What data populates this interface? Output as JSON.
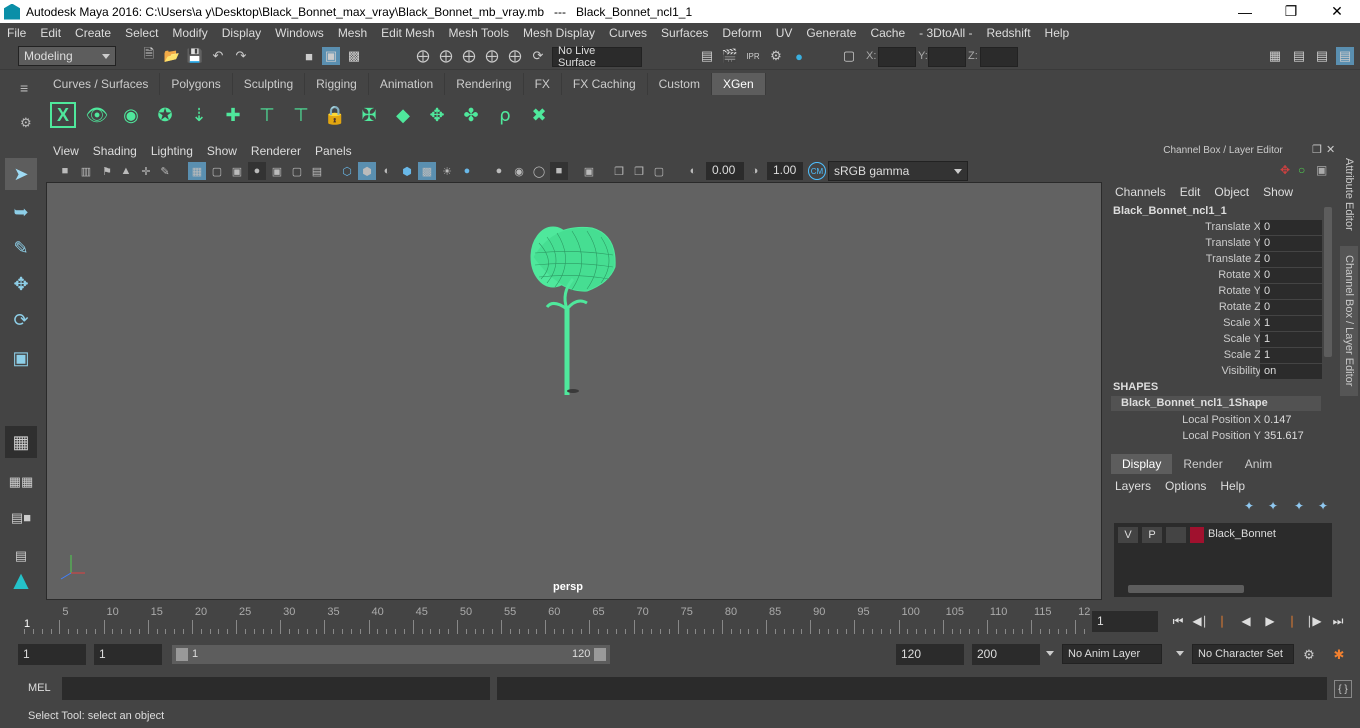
{
  "title": "Autodesk Maya 2016: C:\\Users\\a y\\Desktop\\Black_Bonnet_max_vray\\Black_Bonnet_mb_vray.mb   ---   Black_Bonnet_ncl1_1",
  "menubar": [
    "File",
    "Edit",
    "Create",
    "Select",
    "Modify",
    "Display",
    "Windows",
    "Mesh",
    "Edit Mesh",
    "Mesh Tools",
    "Mesh Display",
    "Curves",
    "Surfaces",
    "Deform",
    "UV",
    "Generate",
    "Cache",
    "- 3DtoAll -",
    "Redshift",
    "Help"
  ],
  "status": {
    "mode": "Modeling",
    "live_surface": "No Live Surface",
    "x_label": "X:",
    "y_label": "Y:",
    "z_label": "Z:"
  },
  "shelf_tabs": [
    "Curves / Surfaces",
    "Polygons",
    "Sculpting",
    "Rigging",
    "Animation",
    "Rendering",
    "FX",
    "FX Caching",
    "Custom",
    "XGen"
  ],
  "shelf_active": "XGen",
  "viewport_menu": [
    "View",
    "Shading",
    "Lighting",
    "Show",
    "Renderer",
    "Panels"
  ],
  "viewport": {
    "exposure": "0.00",
    "gamma": "1.00",
    "color_space": "sRGB gamma",
    "camera": "persp",
    "model_color": "#4fe89c",
    "bg_color": "#626262"
  },
  "channel_box": {
    "title": "Channel Box / Layer Editor",
    "menu": [
      "Channels",
      "Edit",
      "Object",
      "Show"
    ],
    "object": "Black_Bonnet_ncl1_1",
    "attrs": [
      {
        "label": "Translate X",
        "value": "0"
      },
      {
        "label": "Translate Y",
        "value": "0"
      },
      {
        "label": "Translate Z",
        "value": "0"
      },
      {
        "label": "Rotate X",
        "value": "0"
      },
      {
        "label": "Rotate Y",
        "value": "0"
      },
      {
        "label": "Rotate Z",
        "value": "0"
      },
      {
        "label": "Scale X",
        "value": "1"
      },
      {
        "label": "Scale Y",
        "value": "1"
      },
      {
        "label": "Scale Z",
        "value": "1"
      },
      {
        "label": "Visibility",
        "value": "on"
      }
    ],
    "shapes_header": "SHAPES",
    "shape_name": "Black_Bonnet_ncl1_1Shape",
    "shape_attrs": [
      {
        "label": "Local Position X",
        "value": "0.147"
      },
      {
        "label": "Local Position Y",
        "value": "351.617"
      }
    ]
  },
  "layer_editor": {
    "tabs": [
      "Display",
      "Render",
      "Anim"
    ],
    "active_tab": "Display",
    "menu": [
      "Layers",
      "Options",
      "Help"
    ],
    "layer": {
      "v": "V",
      "p": "P",
      "name": "Black_Bonnet",
      "color": "#a0112e"
    }
  },
  "side_tabs": [
    "Attribute Editor",
    "Channel Box / Layer Editor"
  ],
  "timeline": {
    "labels": [
      "5",
      "10",
      "15",
      "20",
      "25",
      "30",
      "35",
      "40",
      "45",
      "50",
      "55",
      "60",
      "65",
      "70",
      "75",
      "80",
      "85",
      "90",
      "95",
      "100",
      "105",
      "110",
      "115",
      "12"
    ],
    "start_marker": "1",
    "current_frame": "1"
  },
  "range": {
    "start": "1",
    "inner_start": "1",
    "slider_start": "1",
    "slider_end": "120",
    "end": "120",
    "outer_end": "200",
    "anim_layer": "No Anim Layer",
    "char_set": "No Character Set"
  },
  "mel": {
    "label": "MEL"
  },
  "help_line": "Select Tool: select an object"
}
